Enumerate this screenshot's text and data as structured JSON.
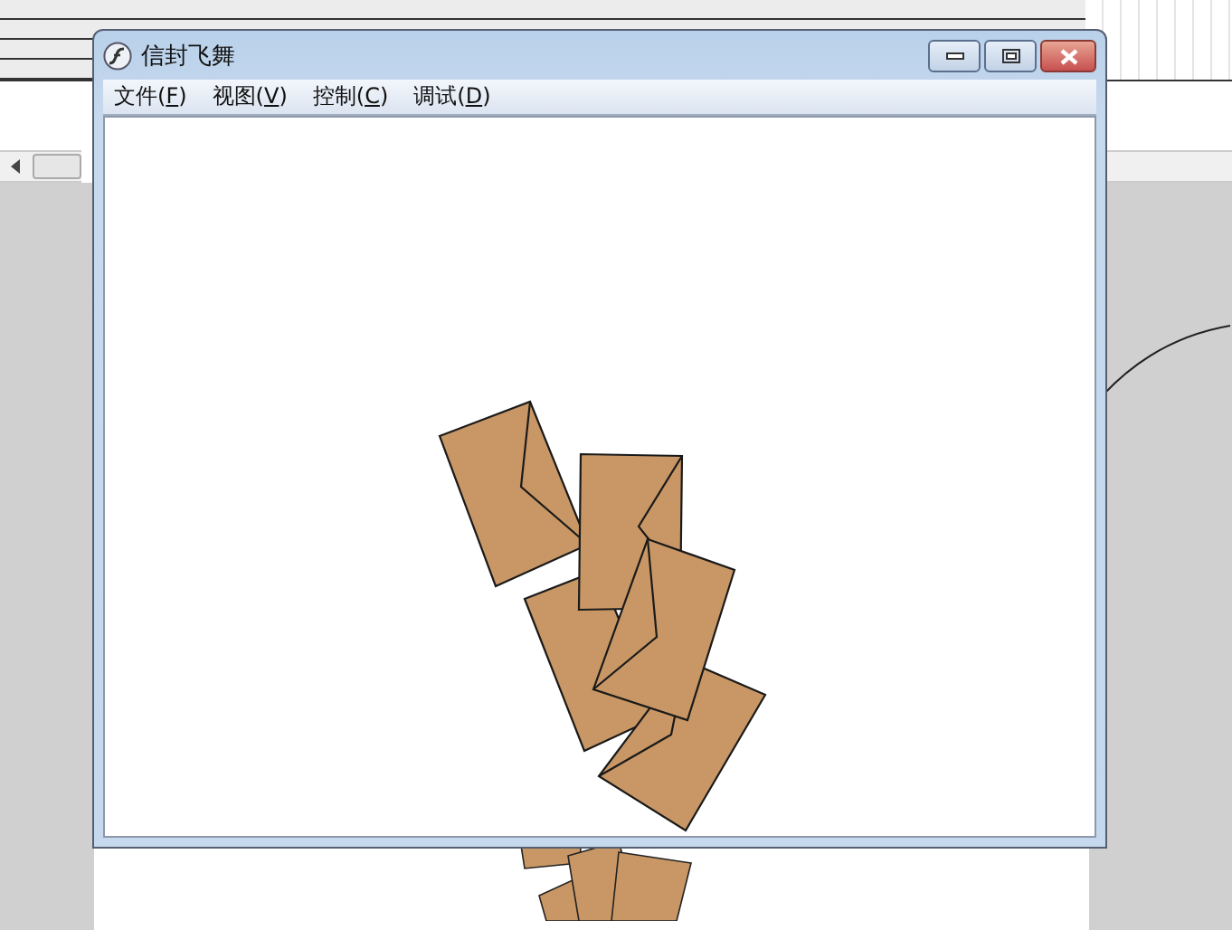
{
  "window": {
    "title": "信封飞舞"
  },
  "menu": [
    {
      "label": "文件(F)"
    },
    {
      "label": "视图(V)"
    },
    {
      "label": "控制(C)"
    },
    {
      "label": "调试(D)"
    }
  ]
}
